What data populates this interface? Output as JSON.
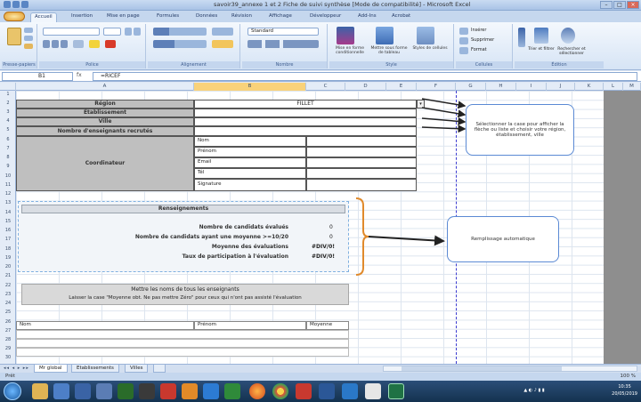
{
  "window": {
    "title": "savoir39_annexe 1 et 2 Fiche de suivi synthèse [Mode de compatibilité] - Microsoft Excel"
  },
  "ribbon": {
    "tabs": [
      "Accueil",
      "Insertion",
      "Mise en page",
      "Formules",
      "Données",
      "Révision",
      "Affichage",
      "Développeur",
      "Add-Ins",
      "Acrobat"
    ],
    "groups": [
      "Presse-papiers",
      "Police",
      "Alignement",
      "Nombre",
      "Style",
      "Cellules",
      "Édition"
    ],
    "number_format": "Standard",
    "style_buttons": [
      "Mise en forme conditionnelle",
      "Mettre sous forme de tableau",
      "Styles de cellules"
    ],
    "cell_buttons": [
      "Insérer",
      "Supprimer",
      "Format"
    ],
    "edit_buttons": [
      "Trier et filtrer",
      "Rechercher et sélectionner"
    ]
  },
  "formula_bar": {
    "cell_ref": "B1",
    "fx": "fx",
    "formula": "=RICEF"
  },
  "columns": [
    "A",
    "B",
    "C",
    "D",
    "E",
    "F",
    "G",
    "H",
    "I",
    "J",
    "K",
    "L",
    "M"
  ],
  "rows": [
    "1",
    "2",
    "3",
    "4",
    "5",
    "6",
    "7",
    "8",
    "9",
    "10",
    "11",
    "12",
    "13",
    "14",
    "15",
    "16",
    "17",
    "18",
    "19",
    "20",
    "21",
    "22",
    "23",
    "24",
    "25",
    "26",
    "27",
    "28",
    "29",
    "30"
  ],
  "form": {
    "labels": {
      "region": "Région",
      "etab": "Établissement",
      "ville": "Ville",
      "nombre": "Nombre d'enseignants recrutés",
      "coordinateur": "Coordinateur"
    },
    "region_value": "FILLET",
    "coord_fields": [
      "Nom",
      "Prénom",
      "Email",
      "Tél",
      "Signature"
    ]
  },
  "summary": {
    "header": "Renseignements",
    "lines": [
      {
        "label": "Nombre de candidats évalués",
        "value": "0"
      },
      {
        "label": "Nombre de candidats ayant une moyenne >=10/20",
        "value": "0"
      },
      {
        "label": "Moyenne des évaluations",
        "value": "#DIV/0!"
      },
      {
        "label": "Taux de participation à l'évaluation",
        "value": "#DIV/0!"
      }
    ]
  },
  "instructions": {
    "line1": "Mettre les noms de tous les enseignants",
    "line2": "Laisser la case \"Moyenne obt. Ne pas mettre Zéro\" pour ceux qui n'ont pas assisté l'évaluation"
  },
  "bottom_table": {
    "headers": [
      "Nom",
      "Prénom",
      "Moyenne"
    ]
  },
  "callouts": {
    "top": "Sélectionner la case pour afficher la flèche ou liste et choisir votre région, établissement, ville",
    "bottom": "Remplissage automatique"
  },
  "sheet_tabs": [
    "Mr global",
    "Etablissements",
    "Villes"
  ],
  "status": {
    "ready": "Prêt",
    "zoom": "100 %"
  },
  "taskbar": {
    "time": "10:35",
    "date": "20/05/2019"
  }
}
